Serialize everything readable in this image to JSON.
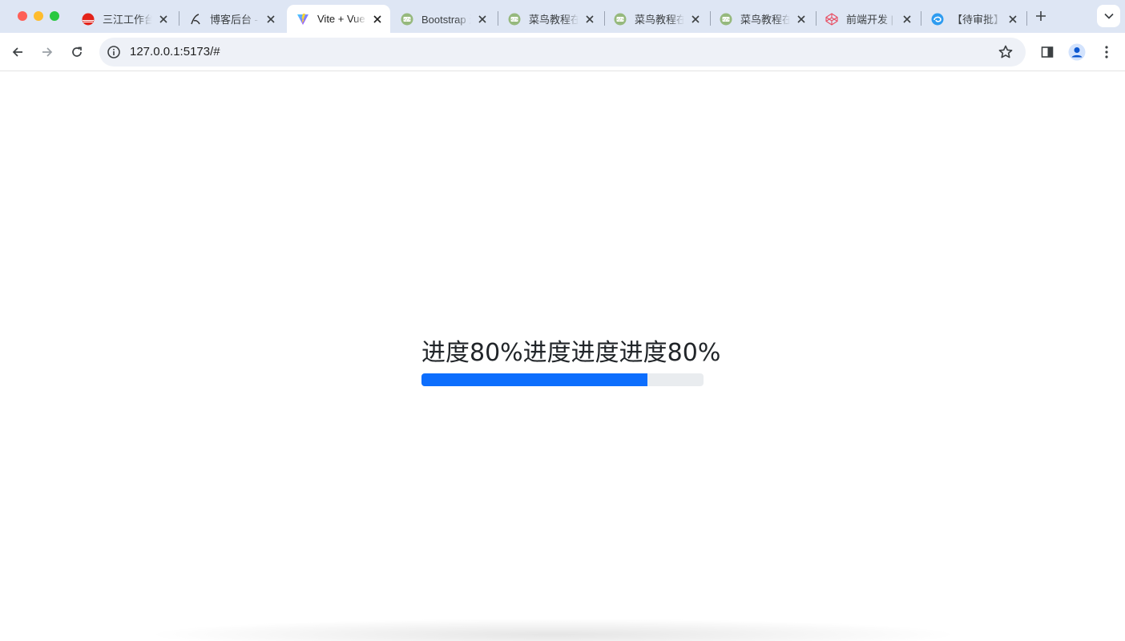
{
  "browser": {
    "tabs": [
      {
        "title": "三江工作台",
        "favicon": "red-circle-icon",
        "active": false
      },
      {
        "title": "博客后台 - 文章",
        "favicon": "pen-logo-icon",
        "active": false
      },
      {
        "title": "Vite + Vue",
        "favicon": "vite-logo-icon",
        "active": true
      },
      {
        "title": "Bootstrap 进度条",
        "favicon": "runoob-icon",
        "active": false
      },
      {
        "title": "菜鸟教程在线编辑器",
        "favicon": "runoob-icon",
        "active": false
      },
      {
        "title": "菜鸟教程在线编辑器",
        "favicon": "runoob-icon",
        "active": false
      },
      {
        "title": "菜鸟教程在线编辑器",
        "favicon": "runoob-icon",
        "active": false
      },
      {
        "title": "前端开发 | 工具",
        "favicon": "codepen-icon",
        "active": false
      },
      {
        "title": "【待审批】",
        "favicon": "swirl-logo-icon",
        "active": false
      }
    ],
    "new_tab_icon": "plus-icon",
    "tab_search_icon": "chevron-down-icon",
    "url": "127.0.0.1:5173/#",
    "toolbar_icons": [
      "back-arrow-icon",
      "forward-arrow-icon",
      "reload-icon",
      "site-info-icon",
      "bookmark-star-icon",
      "side-panel-icon",
      "profile-icon",
      "kebab-menu-icon"
    ]
  },
  "page": {
    "progress_text": "进度80%进度进度进度80%",
    "progress_value_percent": 80,
    "progress_bar_color": "#0d6efd",
    "progress_track_color": "#e9ecef"
  }
}
